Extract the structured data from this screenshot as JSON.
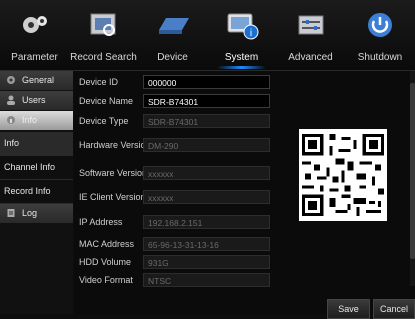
{
  "topnav": {
    "items": [
      {
        "label": "Parameter",
        "icon": "gears-icon"
      },
      {
        "label": "Record Search",
        "icon": "film-icon"
      },
      {
        "label": "Device",
        "icon": "hdd-icon"
      },
      {
        "label": "System",
        "icon": "monitor-info-icon",
        "active": true
      },
      {
        "label": "Advanced",
        "icon": "sliders-icon"
      },
      {
        "label": "Shutdown",
        "icon": "power-icon"
      }
    ]
  },
  "sidebar": {
    "general": "General",
    "users": "Users",
    "info": "Info",
    "info_sub": "Info",
    "channel_info": "Channel Info",
    "record_info": "Record Info",
    "log": "Log"
  },
  "device": {
    "id_label": "Device ID",
    "id_value": "000000",
    "name_label": "Device Name",
    "name_value": "SDR-B74301",
    "type_label": "Device Type",
    "type_value": "SDR-B74301",
    "hw_label": "Hardware Version",
    "hw_value": "DM-290",
    "sw_label": "Software Version",
    "sw_value": "xxxxxx",
    "ie_label": "IE Client Version",
    "ie_value": "xxxxxx",
    "ip_label": "IP Address",
    "ip_value": "192.168.2.151",
    "mac_label": "MAC Address",
    "mac_value": "65-96-13-31-13-16",
    "hdd_label": "HDD Volume",
    "hdd_value": "931G",
    "video_label": "Video Format",
    "video_value": "NTSC"
  },
  "buttons": {
    "save": "Save",
    "cancel": "Cancel"
  },
  "colors": {
    "accent": "#1e8bff",
    "background": "#0d0d0d"
  }
}
